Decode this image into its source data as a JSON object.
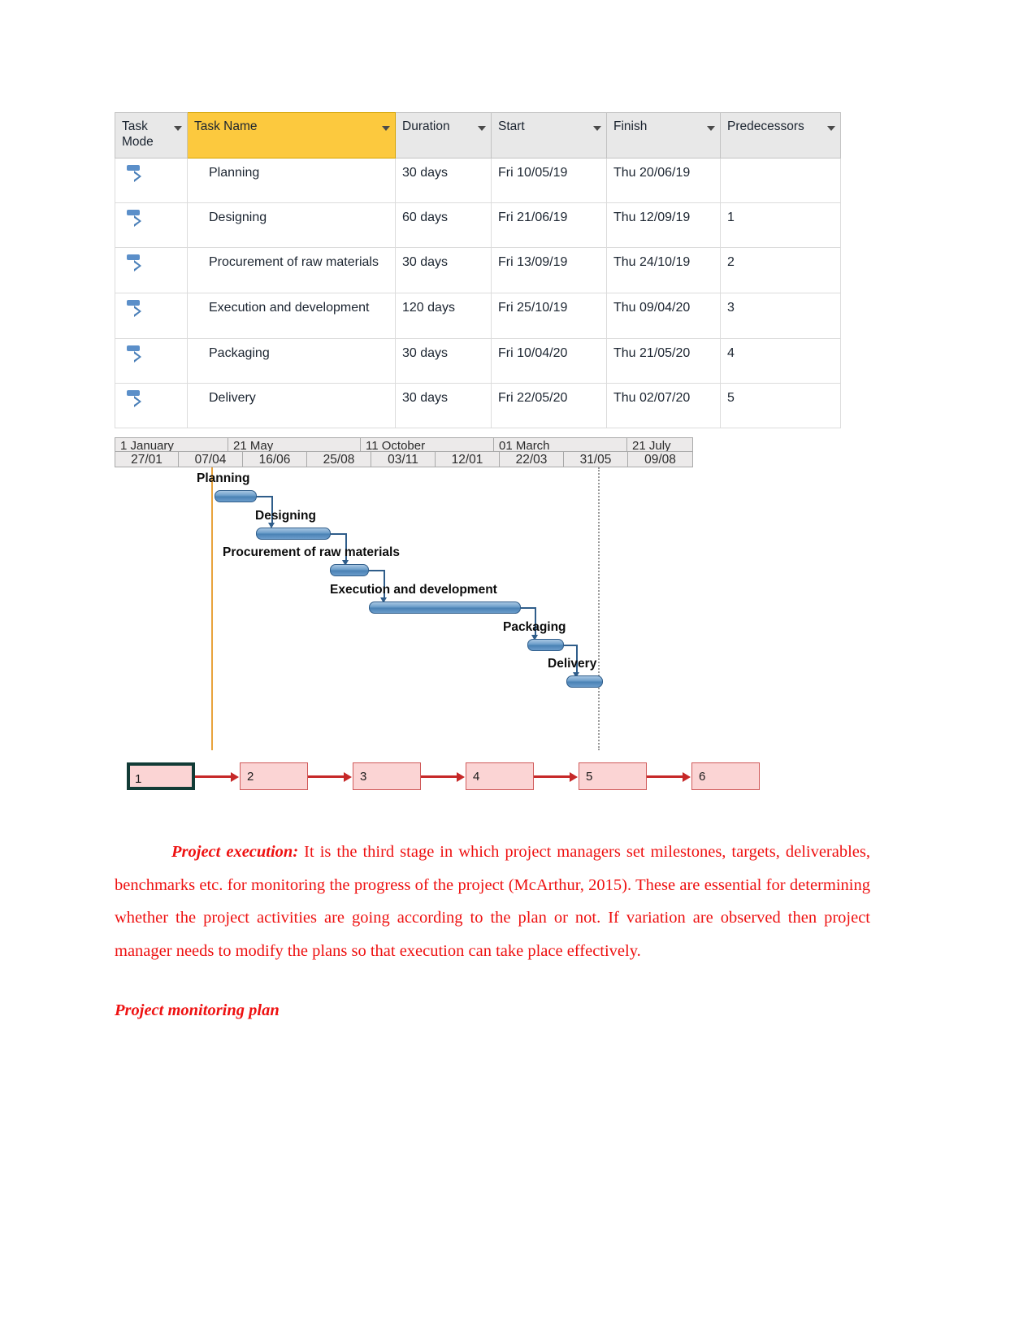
{
  "project_table": {
    "columns": [
      {
        "label": "Task Mode",
        "highlight": false
      },
      {
        "label": "Task Name",
        "highlight": true
      },
      {
        "label": "Duration",
        "highlight": false
      },
      {
        "label": "Start",
        "highlight": false
      },
      {
        "label": "Finish",
        "highlight": false
      },
      {
        "label": "Predecessors",
        "highlight": false
      }
    ],
    "rows": [
      {
        "mode_icon": "auto-schedule-icon",
        "name": "Planning",
        "duration": "30 days",
        "start": "Fri 10/05/19",
        "finish": "Thu 20/06/19",
        "predecessors": ""
      },
      {
        "mode_icon": "auto-schedule-icon",
        "name": "Designing",
        "duration": "60 days",
        "start": "Fri 21/06/19",
        "finish": "Thu 12/09/19",
        "predecessors": "1"
      },
      {
        "mode_icon": "auto-schedule-icon",
        "name": "Procurement of raw materials",
        "duration": "30 days",
        "start": "Fri 13/09/19",
        "finish": "Thu 24/10/19",
        "predecessors": "2"
      },
      {
        "mode_icon": "auto-schedule-icon",
        "name": "Execution and development",
        "duration": "120 days",
        "start": "Fri 25/10/19",
        "finish": "Thu 09/04/20",
        "predecessors": "3"
      },
      {
        "mode_icon": "auto-schedule-icon",
        "name": "Packaging",
        "duration": "30 days",
        "start": "Fri 10/04/20",
        "finish": "Thu 21/05/20",
        "predecessors": "4"
      },
      {
        "mode_icon": "auto-schedule-icon",
        "name": "Delivery",
        "duration": "30 days",
        "start": "Fri 22/05/20",
        "finish": "Thu 02/07/20",
        "predecessors": "5"
      }
    ]
  },
  "gantt": {
    "major_ticks": [
      "1 January",
      "21 May",
      "11 October",
      "01 March",
      "21 July"
    ],
    "minor_ticks": [
      "27/01",
      "07/04",
      "16/06",
      "25/08",
      "03/11",
      "12/01",
      "22/03",
      "31/05",
      "09/08"
    ],
    "bars": [
      {
        "label": "Planning",
        "duration": "30 days"
      },
      {
        "label": "Designing",
        "duration": "60 days"
      },
      {
        "label": "Procurement of raw materials",
        "duration": "30 days"
      },
      {
        "label": "Execution and development",
        "duration": "120 days"
      },
      {
        "label": "Packaging",
        "duration": "30 days"
      },
      {
        "label": "Delivery",
        "duration": "30 days"
      }
    ]
  },
  "network_diagram": {
    "nodes": [
      "1",
      "2",
      "3",
      "4",
      "5",
      "6"
    ]
  },
  "content": {
    "paragraph_lead": "Project execution:",
    "paragraph_body": " It is the third stage in which project managers set milestones, targets, deliverables, benchmarks etc. for monitoring the progress of the project (McArthur, 2015). These are essential for determining whether the project activities are going according to the plan or not. If variation are observed then project manager needs to modify the plans so that execution can take place effectively.",
    "subheading": "Project monitoring plan"
  },
  "colors": {
    "text_red": "#ee1111",
    "header_highlight": "#fcc93e",
    "bar_blue": "#4a82b5",
    "node_pink": "#fbd4d4",
    "arrow_red": "#c62828",
    "progress_line": "#e8a33d"
  }
}
